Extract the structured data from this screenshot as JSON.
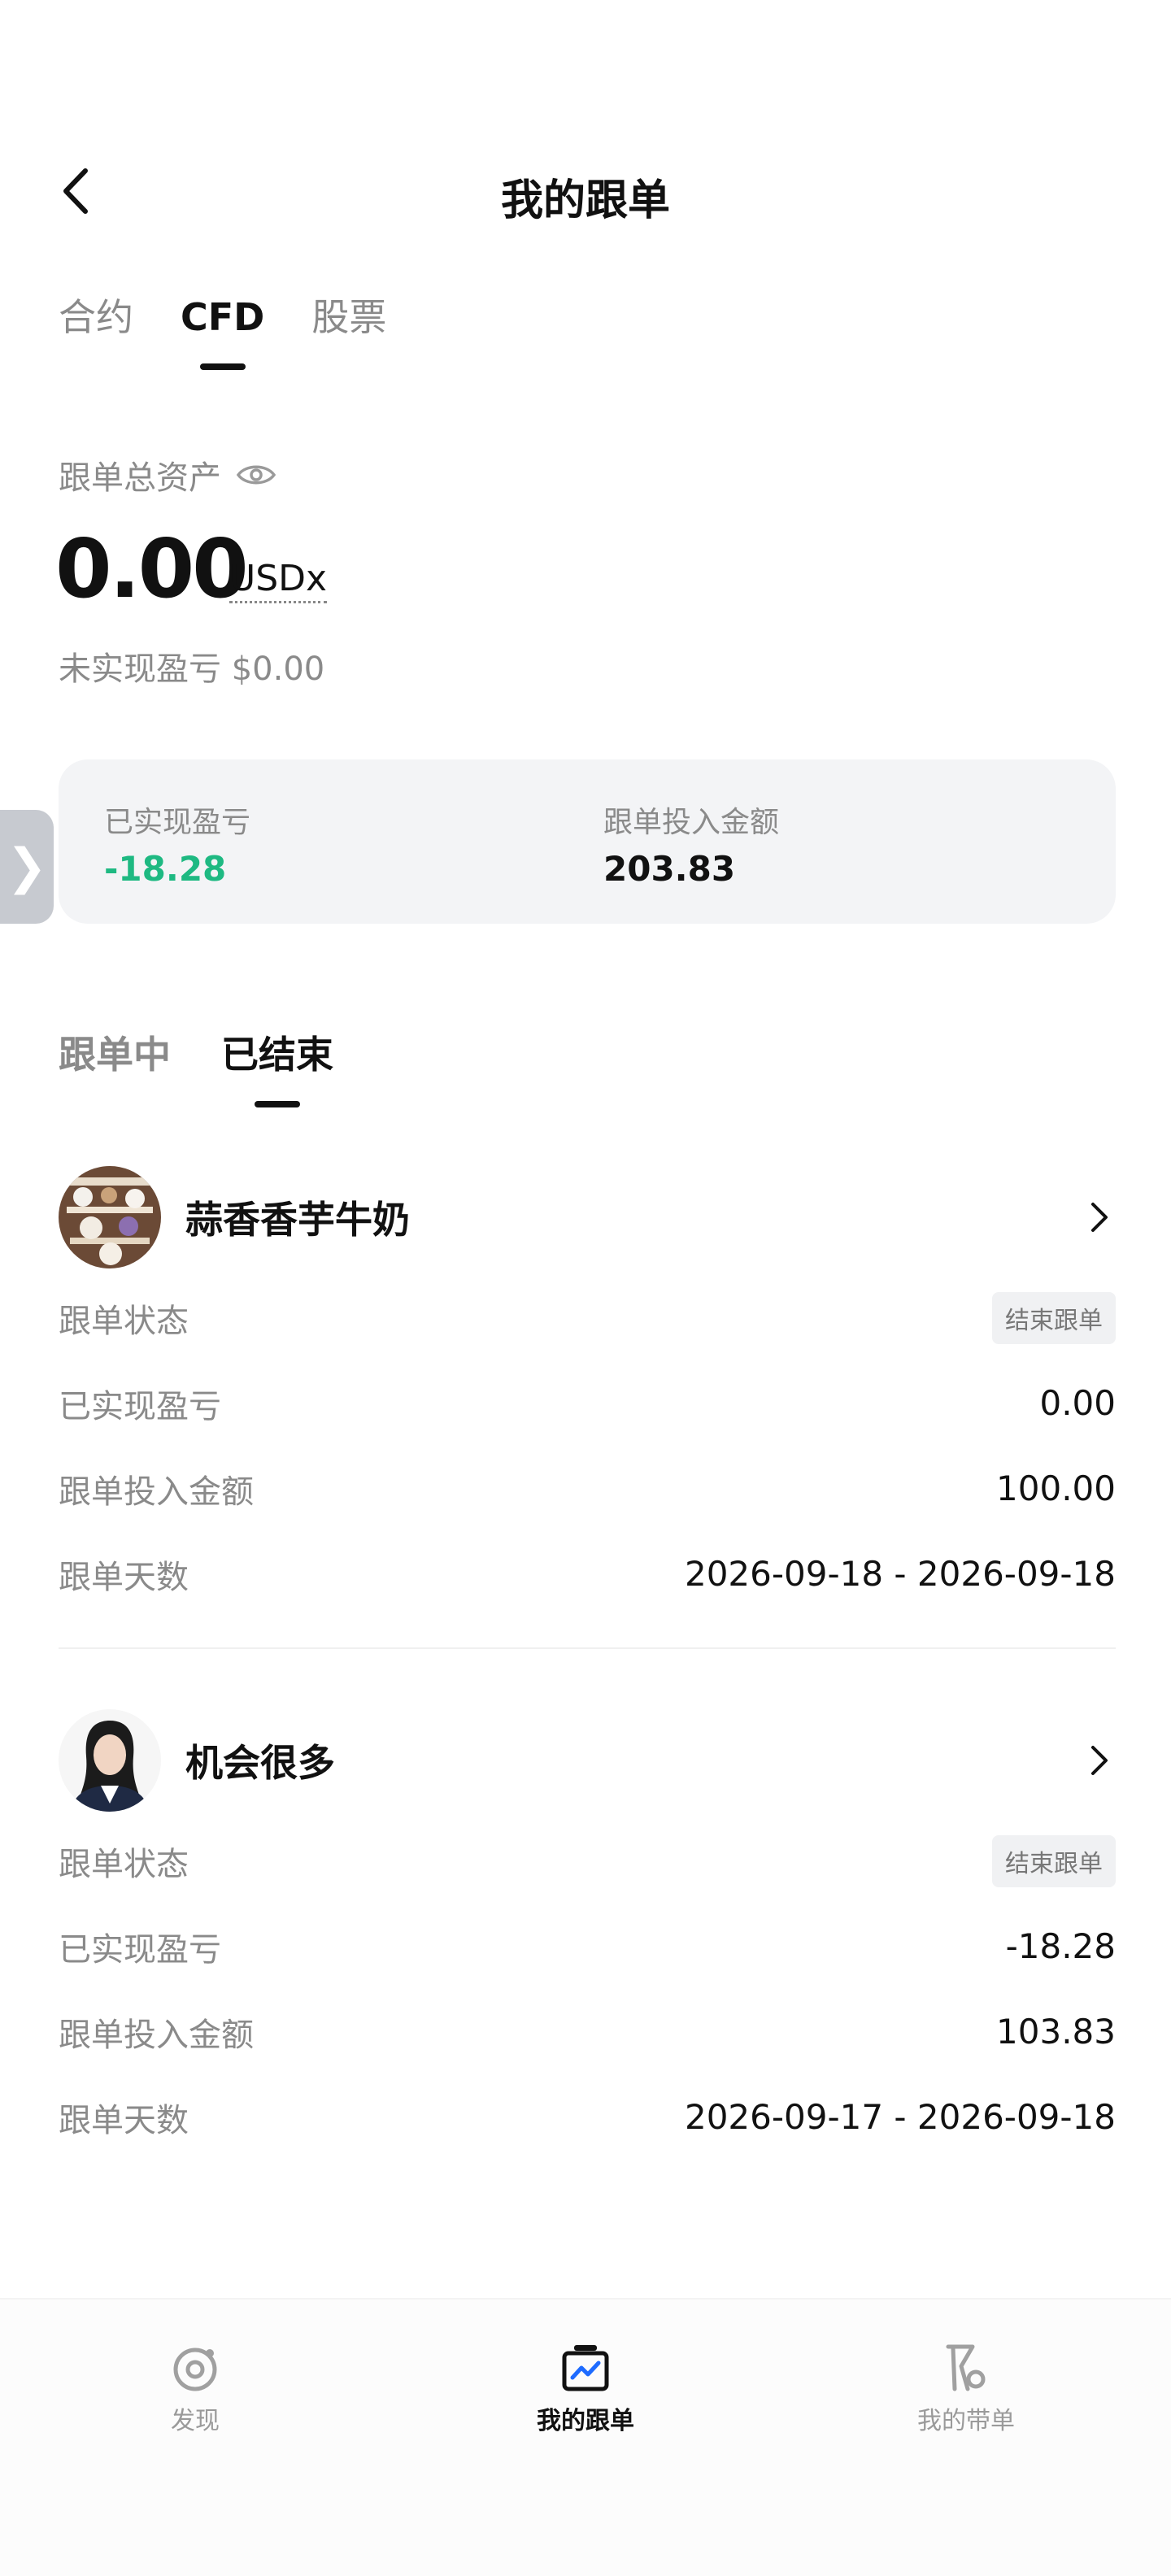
{
  "header": {
    "title": "我的跟单"
  },
  "top_tabs": [
    {
      "label": "合约"
    },
    {
      "label": "CFD"
    },
    {
      "label": "股票"
    }
  ],
  "assets": {
    "label": "跟单总资产",
    "value": "0.00",
    "unit": "USDx",
    "unrealized_label": "未实现盈亏 $0.00"
  },
  "summary": {
    "realized_label": "已实现盈亏",
    "realized_value": "-18.28",
    "invest_label": "跟单投入金额",
    "invest_value": "203.83"
  },
  "sub_tabs": [
    {
      "label": "跟单中"
    },
    {
      "label": "已结束"
    }
  ],
  "traders": [
    {
      "name": "蒜香香芋牛奶",
      "status_label": "跟单状态",
      "status_badge": "结束跟单",
      "pnl_label": "已实现盈亏",
      "pnl_value": "0.00",
      "invest_label": "跟单投入金额",
      "invest_value": "100.00",
      "days_label": "跟单天数",
      "days_value": "2026-09-18 - 2026-09-18"
    },
    {
      "name": "机会很多",
      "status_label": "跟单状态",
      "status_badge": "结束跟单",
      "pnl_label": "已实现盈亏",
      "pnl_value": "-18.28",
      "invest_label": "跟单投入金额",
      "invest_value": "103.83",
      "days_label": "跟单天数",
      "days_value": "2026-09-17 - 2026-09-18"
    }
  ],
  "bottom_nav": [
    {
      "label": "发现",
      "icon": "discover-icon"
    },
    {
      "label": "我的跟单",
      "icon": "my-copy-icon"
    },
    {
      "label": "我的带单",
      "icon": "my-lead-icon"
    }
  ],
  "colors": {
    "positive_green": "#1eb982",
    "card_bg": "#f3f4f6"
  }
}
